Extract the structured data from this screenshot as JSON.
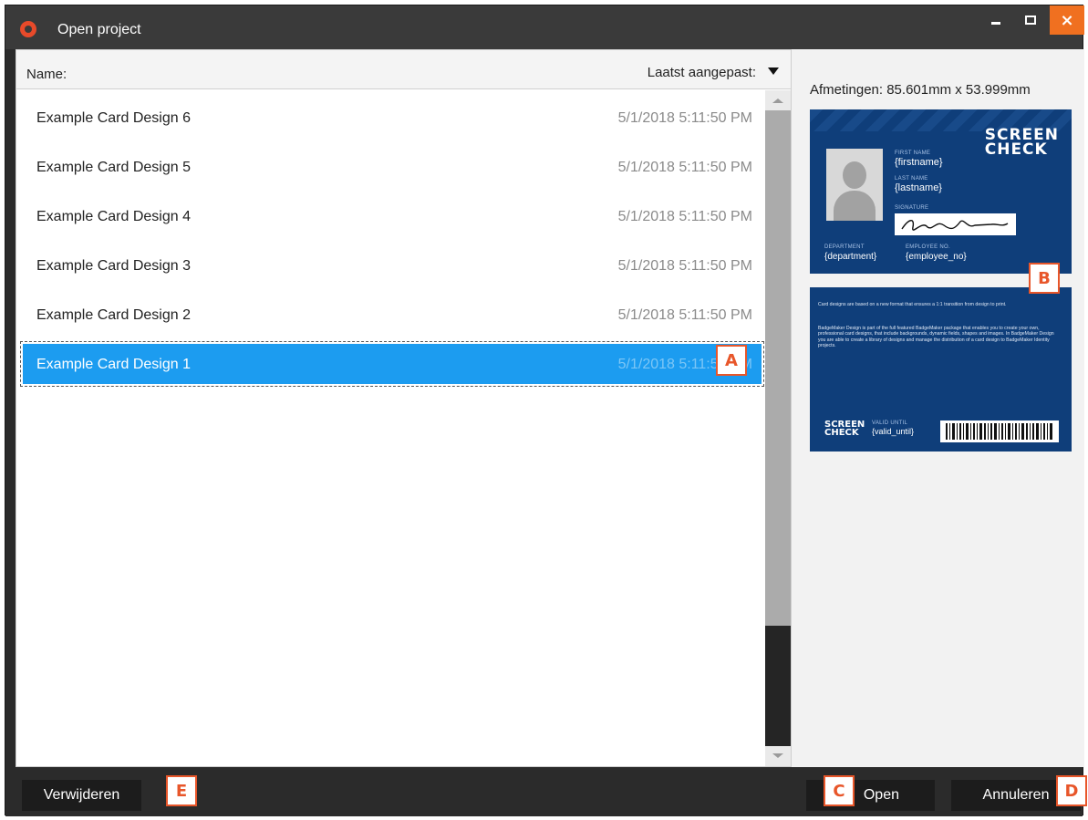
{
  "window": {
    "title": "Open project",
    "controls": {
      "minimize": "minimize",
      "maximize": "maximize",
      "close": "×"
    }
  },
  "list": {
    "headers": {
      "name": "Name:",
      "modified": "Laatst aangepast:"
    },
    "rows": [
      {
        "name": "Example Card Design 6",
        "date": "5/1/2018 5:11:50 PM",
        "selected": false
      },
      {
        "name": "Example Card Design 5",
        "date": "5/1/2018 5:11:50 PM",
        "selected": false
      },
      {
        "name": "Example Card Design 4",
        "date": "5/1/2018 5:11:50 PM",
        "selected": false
      },
      {
        "name": "Example Card Design 3",
        "date": "5/1/2018 5:11:50 PM",
        "selected": false
      },
      {
        "name": "Example Card Design 2",
        "date": "5/1/2018 5:11:50 PM",
        "selected": false
      },
      {
        "name": "Example Card Design 1",
        "date": "5/1/2018 5:11:50 PM",
        "selected": true
      }
    ]
  },
  "preview": {
    "dimensions": "Afmetingen: 85.601mm  x  53.999mm",
    "front": {
      "logo_line1": "SCREEN",
      "logo_line2": "CHECK",
      "first_name_label": "FIRST NAME",
      "first_name_value": "{firstname}",
      "last_name_label": "LAST NAME",
      "last_name_value": "{lastname}",
      "signature_label": "SIGNATURE",
      "department_label": "DEPARTMENT",
      "department_value": "{department}",
      "employee_label": "EMPLOYEE NO.",
      "employee_value": "{employee_no}"
    },
    "back": {
      "text1": "Card designs are based on a new format that ensures a 1:1 transition from design to print.",
      "text2": "BadgeMaker Design is part of the full featured BadgeMaker package that enables you to create your own, professional card designs, that include backgrounds, dynamic fields, shapes and images. In BadgeMaker Design you are able to create a library of designs and manage the distribution of a card design to BadgeMaker Identity projects.",
      "logo_line1": "SCREEN",
      "logo_line2": "CHECK",
      "valid_label": "VALID UNTIL",
      "valid_value": "{valid_until}"
    }
  },
  "markers": {
    "a": "A",
    "b": "B",
    "c": "C",
    "d": "D",
    "e": "E"
  },
  "footer": {
    "delete_label": "Verwijderen",
    "open_label": "Open",
    "cancel_label": "Annuleren"
  },
  "colors": {
    "selection": "#1c9cf0",
    "close_button": "#f07020",
    "marker": "#e8562a",
    "card_blue": "#0f3e7a"
  }
}
